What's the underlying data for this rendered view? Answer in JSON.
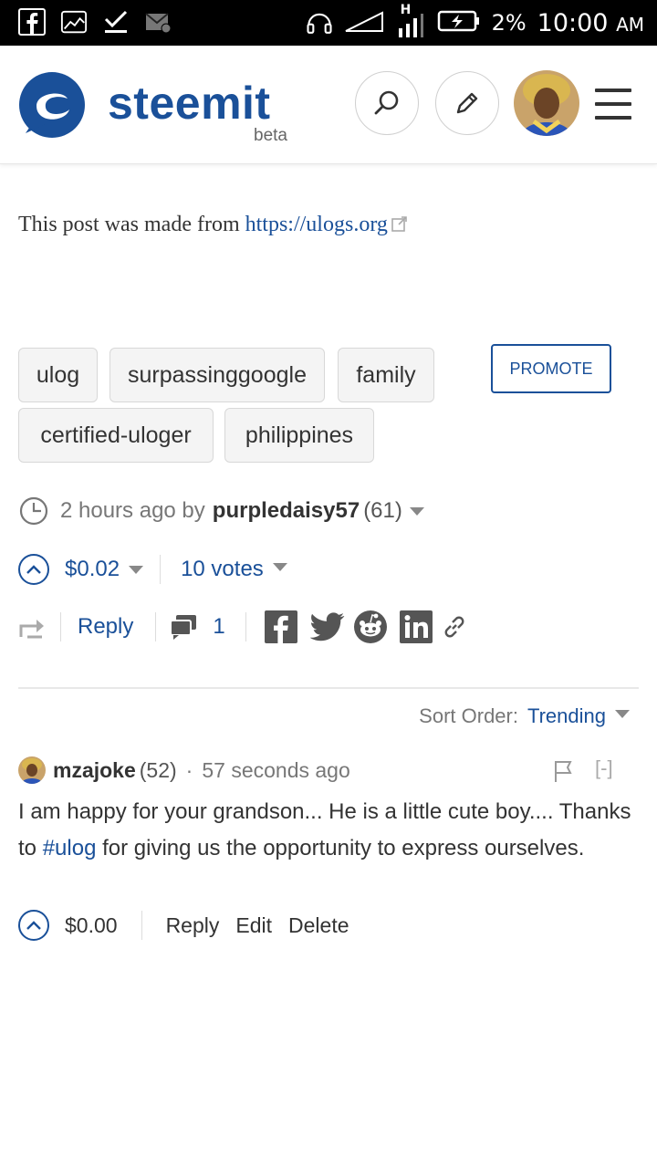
{
  "status_bar": {
    "battery": "2%",
    "time": "10:00",
    "ampm": "AM",
    "network_label": "H"
  },
  "header": {
    "logo_text": "steemit",
    "logo_sub": "beta",
    "search_icon": "search-icon",
    "edit_icon": "pencil-icon",
    "menu_icon": "hamburger-icon",
    "brand_color": "#1a5099"
  },
  "post": {
    "body_prefix": "This post was made from",
    "link_text": "https://ulogs.org",
    "tags": [
      "ulog",
      "surpassinggoogle",
      "family",
      "certified-uloger",
      "philippines"
    ],
    "promote_label": "PROMOTE",
    "time_ago": "2 hours ago by",
    "author": "purpledaisy57",
    "reputation": "(61)",
    "payout": "$0.02",
    "votes": "10 votes",
    "reply_label": "Reply",
    "comment_count": "1"
  },
  "comments_section": {
    "sort_label": "Sort Order:",
    "sort_value": "Trending"
  },
  "comment": {
    "author": "mzajoke",
    "reputation": "(52)",
    "separator": "·",
    "time": "57 seconds ago",
    "collapse": "[-]",
    "body_before": "I am happy for your grandson... He is a little cute boy.... Thanks to",
    "hashtag": "#ulog",
    "body_after": "for giving us the opportunity to express ourselves.",
    "payout": "$0.00",
    "reply": "Reply",
    "edit": "Edit",
    "delete": "Delete"
  }
}
